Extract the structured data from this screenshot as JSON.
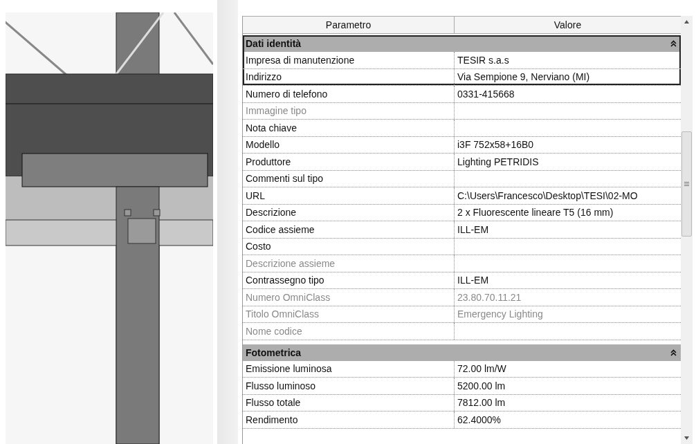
{
  "table": {
    "columns": [
      "Parametro",
      "Valore"
    ],
    "groups": [
      {
        "title": "Dati identità",
        "expanded": true,
        "outlined": true,
        "rows": [
          {
            "param": "Impresa di manutenzione",
            "value": "TESIR s.a.s",
            "disabled": false,
            "outlined": true
          },
          {
            "param": "Indirizzo",
            "value": "Via Sempione 9, Nerviano (MI)",
            "disabled": false,
            "outlined": true
          },
          {
            "param": "Numero di telefono",
            "value": "0331-415668",
            "disabled": false,
            "outlined": false
          },
          {
            "param": "Immagine tipo",
            "disabled": true,
            "outlined": false
          },
          {
            "param": "Nota chiave",
            "disabled": false,
            "outlined": false
          },
          {
            "param": "Modello",
            "value": "i3F 752x58+16B0",
            "disabled": false,
            "outlined": false
          },
          {
            "param": "Produttore",
            "value": "Lighting PETRIDIS",
            "disabled": false,
            "outlined": false
          },
          {
            "param": "Commenti sul tipo",
            "disabled": false,
            "outlined": false
          },
          {
            "param": "URL",
            "value": "C:\\Users\\Francesco\\Desktop\\TESI\\02-MO",
            "disabled": false,
            "outlined": false
          },
          {
            "param": "Descrizione",
            "value": "2 x Fluorescente lineare T5 (16 mm)",
            "disabled": false,
            "outlined": false
          },
          {
            "param": "Codice assieme",
            "value": "ILL-EM",
            "disabled": false,
            "outlined": false
          },
          {
            "param": "Costo",
            "disabled": false,
            "outlined": false
          },
          {
            "param": "Descrizione assieme",
            "disabled": true,
            "outlined": false
          },
          {
            "param": "Contrassegno tipo",
            "value": "ILL-EM",
            "disabled": false,
            "outlined": false
          },
          {
            "param": "Numero OmniClass",
            "value": "23.80.70.11.21",
            "disabled": true,
            "outlined": false
          },
          {
            "param": "Titolo OmniClass",
            "value": "Emergency Lighting",
            "disabled": true,
            "outlined": false
          },
          {
            "param": "Nome codice",
            "disabled": true,
            "outlined": false
          }
        ]
      },
      {
        "title": "Fotometrica",
        "expanded": true,
        "outlined": false,
        "rows": [
          {
            "param": "Emissione luminosa",
            "value": "72.00 lm/W",
            "disabled": false,
            "outlined": false
          },
          {
            "param": "Flusso luminoso",
            "value": "5200.00 lm",
            "disabled": false,
            "outlined": false
          },
          {
            "param": "Flusso totale",
            "value": "7812.00 lm",
            "disabled": false,
            "outlined": false
          },
          {
            "param": "Rendimento",
            "value": "62.4000%",
            "disabled": false,
            "outlined": false
          }
        ]
      }
    ]
  }
}
